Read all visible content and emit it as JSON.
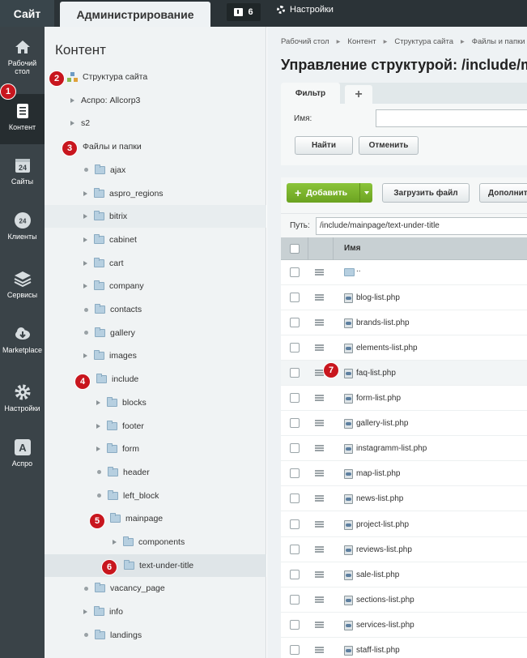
{
  "topbar": {
    "site_tab": "Сайт",
    "admin_tab": "Администрирование",
    "notifications_count": "6",
    "settings_label": "Настройки"
  },
  "leftbar": {
    "items": [
      {
        "label1": "Рабочий",
        "label2": "стол",
        "icon": "home-icon"
      },
      {
        "label1": "Контент",
        "label2": "",
        "icon": "content-icon"
      },
      {
        "label1": "Сайты",
        "label2": "",
        "icon": "calendar-icon",
        "icon_text": "24"
      },
      {
        "label1": "Клиенты",
        "label2": "",
        "icon": "clients-icon",
        "icon_text": "24"
      },
      {
        "label1": "Сервисы",
        "label2": "",
        "icon": "layers-icon"
      },
      {
        "label1": "Marketplace",
        "label2": "",
        "icon": "cloud-download-icon"
      },
      {
        "label1": "Настройки",
        "label2": "",
        "icon": "gear-icon"
      },
      {
        "label1": "Аспро",
        "label2": "",
        "icon": "aspro-icon",
        "icon_text": "A"
      }
    ]
  },
  "tree": {
    "title": "Контент",
    "rows": [
      {
        "label": "Структура сайта",
        "type": "struct"
      },
      {
        "label": "Аспро: Allcorp3",
        "type": "arrow"
      },
      {
        "label": "s2",
        "type": "arrow"
      },
      {
        "label": "Файлы и папки",
        "type": "none"
      },
      {
        "label": "ajax",
        "type": "dot-folder"
      },
      {
        "label": "aspro_regions",
        "type": "arrow-folder"
      },
      {
        "label": "bitrix",
        "type": "arrow-folder"
      },
      {
        "label": "cabinet",
        "type": "arrow-folder"
      },
      {
        "label": "cart",
        "type": "arrow-folder"
      },
      {
        "label": "company",
        "type": "arrow-folder"
      },
      {
        "label": "contacts",
        "type": "dot-folder"
      },
      {
        "label": "gallery",
        "type": "dot-folder"
      },
      {
        "label": "images",
        "type": "arrow-folder"
      },
      {
        "label": "include",
        "type": "folder"
      },
      {
        "label": "blocks",
        "type": "arrow-folder"
      },
      {
        "label": "footer",
        "type": "arrow-folder"
      },
      {
        "label": "form",
        "type": "arrow-folder"
      },
      {
        "label": "header",
        "type": "dot-folder"
      },
      {
        "label": "left_block",
        "type": "dot-folder"
      },
      {
        "label": "mainpage",
        "type": "folder"
      },
      {
        "label": "components",
        "type": "arrow-folder"
      },
      {
        "label": "text-under-title",
        "type": "folder"
      },
      {
        "label": "vacancy_page",
        "type": "dot-folder"
      },
      {
        "label": "info",
        "type": "arrow-folder"
      },
      {
        "label": "landings",
        "type": "dot-folder"
      }
    ]
  },
  "main": {
    "breadcrumb": [
      "Рабочий стол",
      "Контент",
      "Структура сайта",
      "Файлы и папки"
    ],
    "title": "Управление структурой: /include/m",
    "filter": {
      "tab_label": "Фильтр",
      "add_tab": "+",
      "name_label": "Имя:",
      "name_value": "",
      "find_button": "Найти",
      "cancel_button": "Отменить"
    },
    "toolbar": {
      "add_button": "Добавить",
      "upload_button": "Загрузить файл",
      "more_button": "Дополнит"
    },
    "path_label": "Путь:",
    "path_value": "/include/mainpage/text-under-title",
    "column_name": "Имя",
    "up_label": "..",
    "files": [
      "blog-list.php",
      "brands-list.php",
      "elements-list.php",
      "faq-list.php",
      "form-list.php",
      "gallery-list.php",
      "instagramm-list.php",
      "map-list.php",
      "news-list.php",
      "project-list.php",
      "reviews-list.php",
      "sale-list.php",
      "sections-list.php",
      "services-list.php",
      "staff-list.php"
    ]
  },
  "badges": [
    "1",
    "2",
    "3",
    "4",
    "5",
    "6",
    "7"
  ],
  "colors": {
    "topbar": "#2b3337",
    "leftbar": "#3a4348",
    "badge": "#c8161e",
    "add_button": "#7ab52c"
  }
}
